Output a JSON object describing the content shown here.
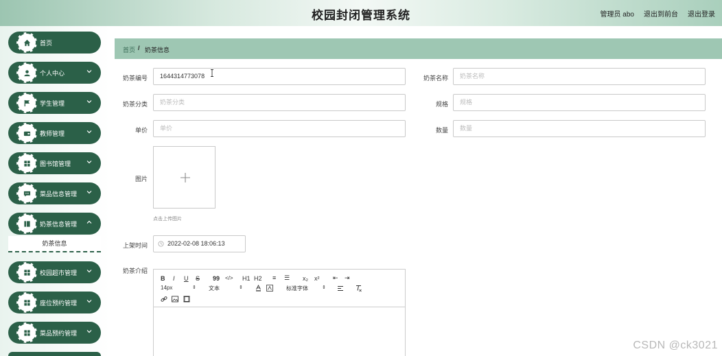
{
  "header": {
    "title": "校园封闭管理系统",
    "user": "管理员 abo",
    "to_front": "退出到前台",
    "logout": "退出登录"
  },
  "sidebar": {
    "items": [
      {
        "label": "首页",
        "icon": "home-icon",
        "has_chevron": false
      },
      {
        "label": "个人中心",
        "icon": "user-icon",
        "has_chevron": true
      },
      {
        "label": "学生管理",
        "icon": "flag-icon",
        "has_chevron": true
      },
      {
        "label": "教师管理",
        "icon": "wallet-icon",
        "has_chevron": true
      },
      {
        "label": "图书馆管理",
        "icon": "grid-icon",
        "has_chevron": true
      },
      {
        "label": "菜品信息管理",
        "icon": "chat-icon",
        "has_chevron": true
      },
      {
        "label": "奶茶信息管理",
        "icon": "book-icon",
        "has_chevron": true
      },
      {
        "label": "校园超市管理",
        "icon": "grid-icon",
        "has_chevron": true
      },
      {
        "label": "座位预约管理",
        "icon": "grid-icon",
        "has_chevron": true
      },
      {
        "label": "菜品预约管理",
        "icon": "grid-icon",
        "has_chevron": true
      }
    ],
    "submenu_active": "奶茶信息"
  },
  "breadcrumb": {
    "home": "首页",
    "separator": "/",
    "current": "奶茶信息"
  },
  "form": {
    "code_label": "奶茶编号",
    "code_value": "1644314773078",
    "name_label": "奶茶名称",
    "name_placeholder": "奶茶名称",
    "category_label": "奶茶分类",
    "category_placeholder": "奶茶分类",
    "spec_label": "规格",
    "spec_placeholder": "规格",
    "price_label": "单价",
    "price_placeholder": "单价",
    "qty_label": "数量",
    "qty_placeholder": "数量",
    "image_label": "图片",
    "upload_hint": "点击上传图片",
    "shelf_label": "上架时间",
    "shelf_value": "2022-02-08 18:06:13",
    "intro_label": "奶茶介绍"
  },
  "editor": {
    "row1": [
      "B",
      "I",
      "U",
      "S",
      "99",
      "</>",
      "H1",
      "H2",
      "≡",
      "☰",
      "x₂",
      "x²",
      "⇤",
      "⇥"
    ],
    "font_size": "14px",
    "text_type": "文本",
    "font_family": "标准字体"
  },
  "watermark": "CSDN @ck3021",
  "colors": {
    "accent": "#2b6048",
    "breadcrumb_bg": "#9ec7b3"
  }
}
